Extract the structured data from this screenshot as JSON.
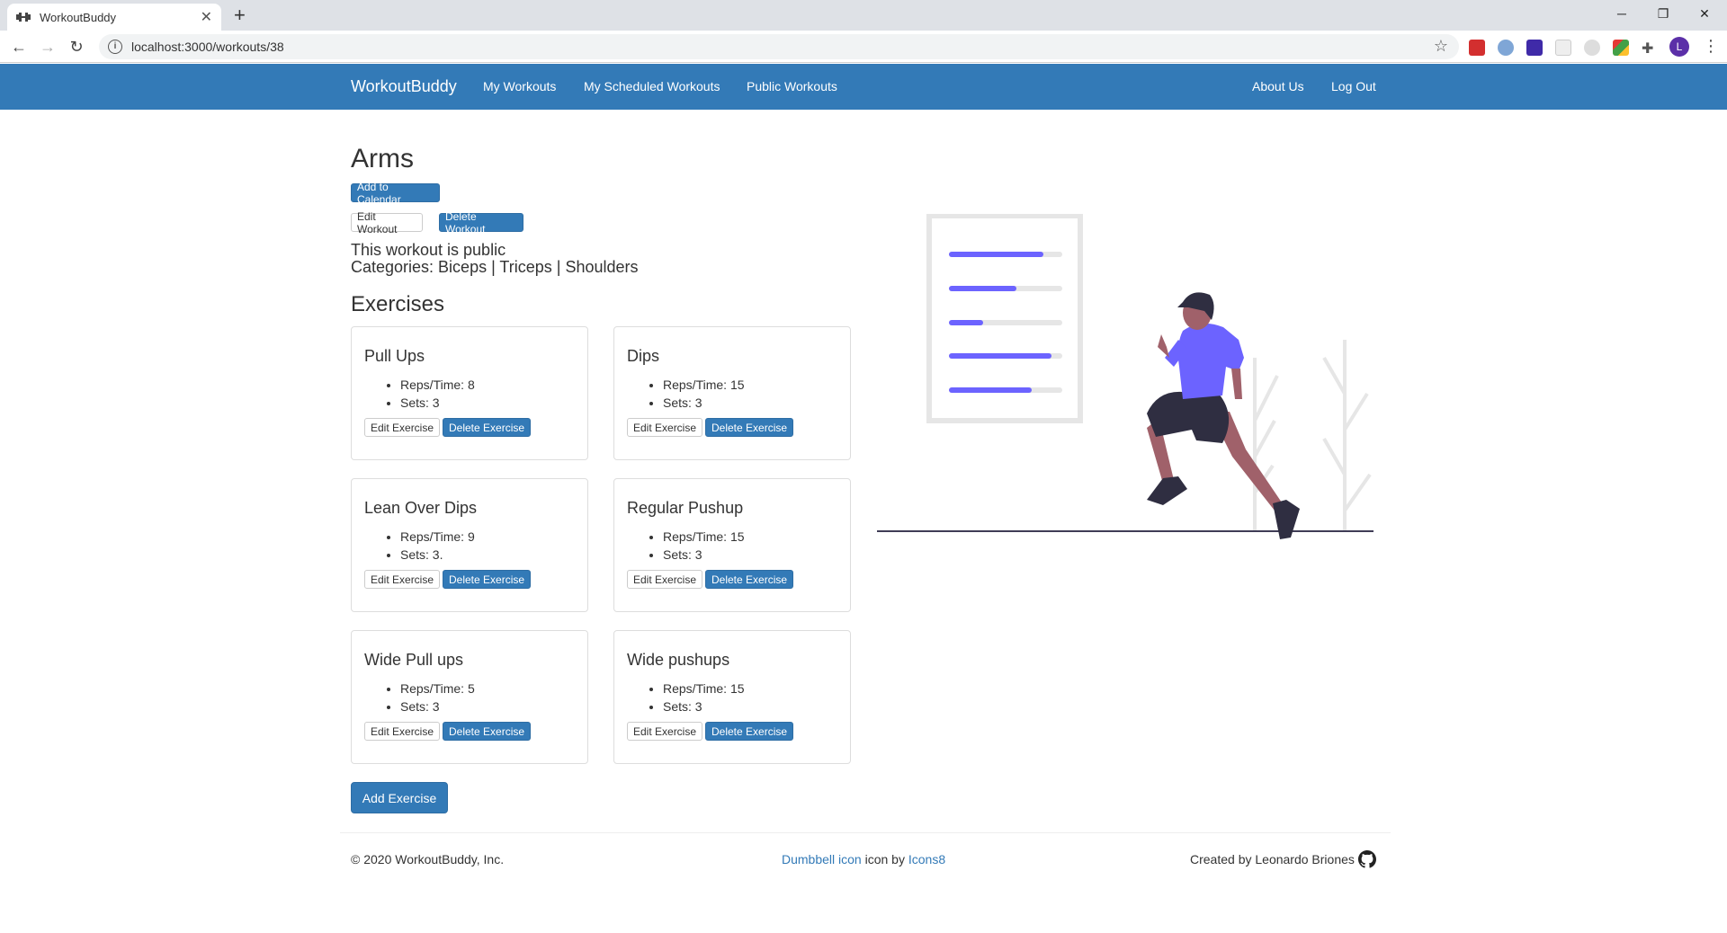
{
  "browser": {
    "tab_title": "WorkoutBuddy",
    "url": "localhost:3000/workouts/38",
    "avatar_letter": "L"
  },
  "nav": {
    "brand": "WorkoutBuddy",
    "links": [
      "My Workouts",
      "My Scheduled Workouts",
      "Public Workouts"
    ],
    "right_links": [
      "About Us",
      "Log Out"
    ]
  },
  "workout": {
    "title": "Arms",
    "add_to_calendar": "Add to Calendar",
    "edit_workout": "Edit Workout",
    "delete_workout": "Delete Workout",
    "visibility": "This workout is public",
    "categories": "Categories: Biceps | Triceps | Shoulders"
  },
  "exercises_heading": "Exercises",
  "exercises": [
    {
      "name": "Pull Ups",
      "reps": "Reps/Time: 8",
      "sets": "Sets: 3"
    },
    {
      "name": "Dips",
      "reps": "Reps/Time: 15",
      "sets": "Sets: 3"
    },
    {
      "name": "Lean Over Dips",
      "reps": "Reps/Time: 9",
      "sets": "Sets: 3."
    },
    {
      "name": "Regular Pushup",
      "reps": "Reps/Time: 15",
      "sets": "Sets: 3"
    },
    {
      "name": "Wide Pull ups",
      "reps": "Reps/Time: 5",
      "sets": "Sets: 3"
    },
    {
      "name": "Wide pushups",
      "reps": "Reps/Time: 15",
      "sets": "Sets: 3"
    }
  ],
  "buttons": {
    "edit_exercise": "Edit Exercise",
    "delete_exercise": "Delete Exercise",
    "add_exercise": "Add Exercise"
  },
  "footer": {
    "copyright": "© 2020 WorkoutBuddy, Inc.",
    "icon_link": "Dumbbell icon",
    "icon_by": " icon by ",
    "icons8": "Icons8",
    "created_by": "Created by Leonardo Briones"
  },
  "colors": {
    "primary": "#337ab7",
    "illustration_accent": "#6c63ff"
  }
}
